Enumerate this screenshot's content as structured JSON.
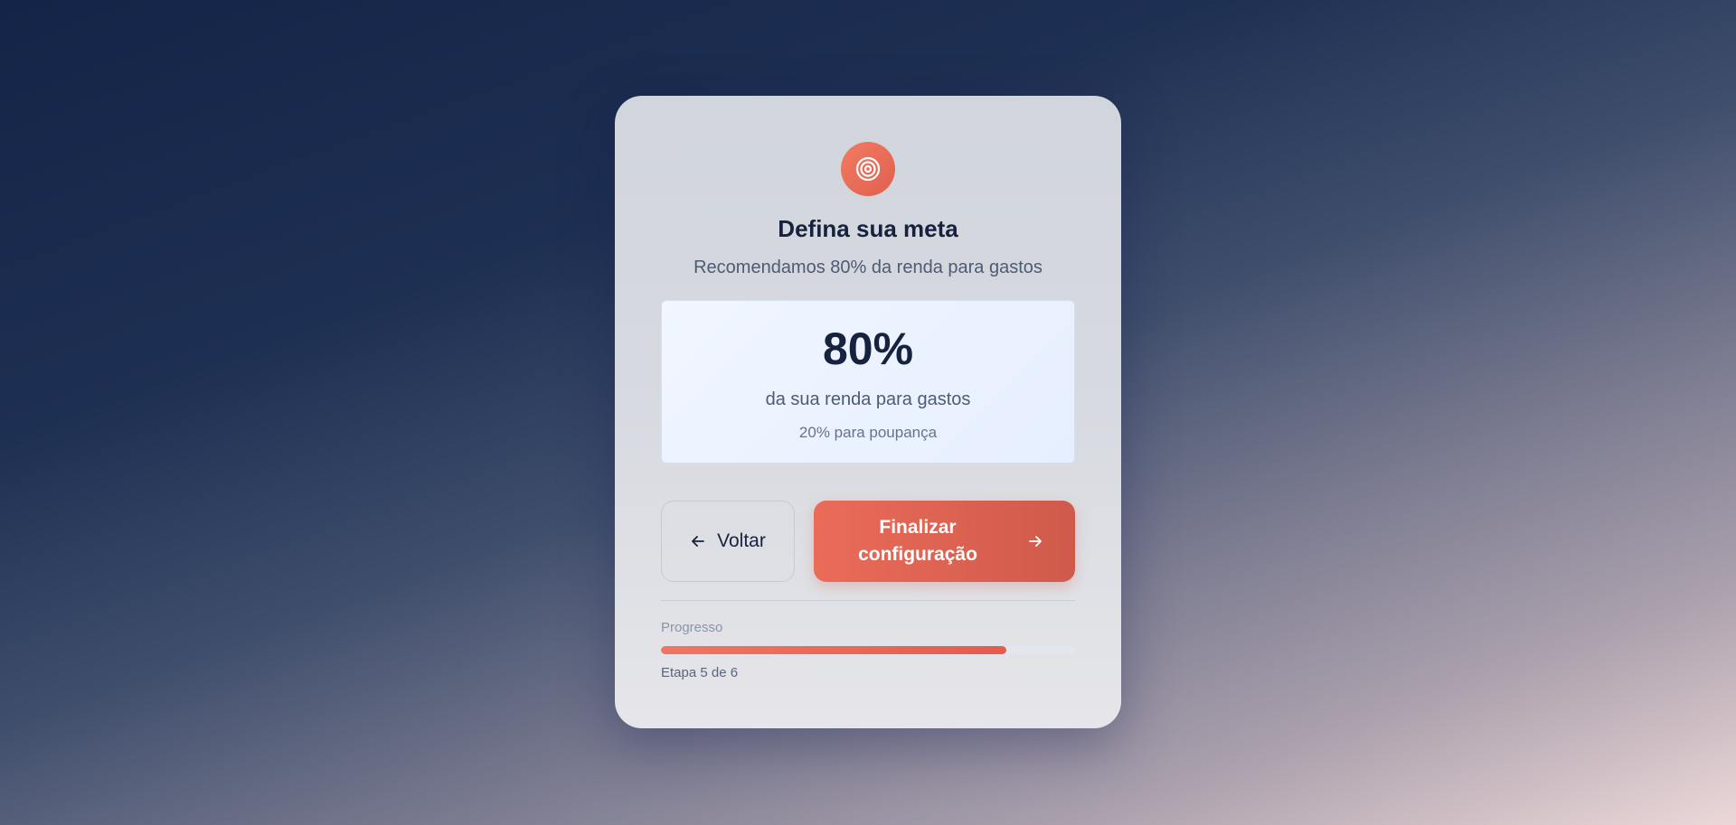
{
  "header": {
    "icon": "target-icon",
    "title": "Defina sua meta",
    "subtitle": "Recomendamos 80% da renda para gastos"
  },
  "goal": {
    "value": "80%",
    "description": "da sua renda para gastos",
    "note": "20% para poupança"
  },
  "buttons": {
    "back_label": "Voltar",
    "back_icon": "arrow-left-icon",
    "finish_label": "Finalizar\nconfiguração",
    "finish_icon": "arrow-right-icon"
  },
  "progress": {
    "label": "Progresso",
    "step_text": "Etapa 5 de 6",
    "fraction": 0.833
  },
  "colors": {
    "accent": "#e8674f",
    "title": "#16223e",
    "goal_box": "#eef4ff"
  }
}
